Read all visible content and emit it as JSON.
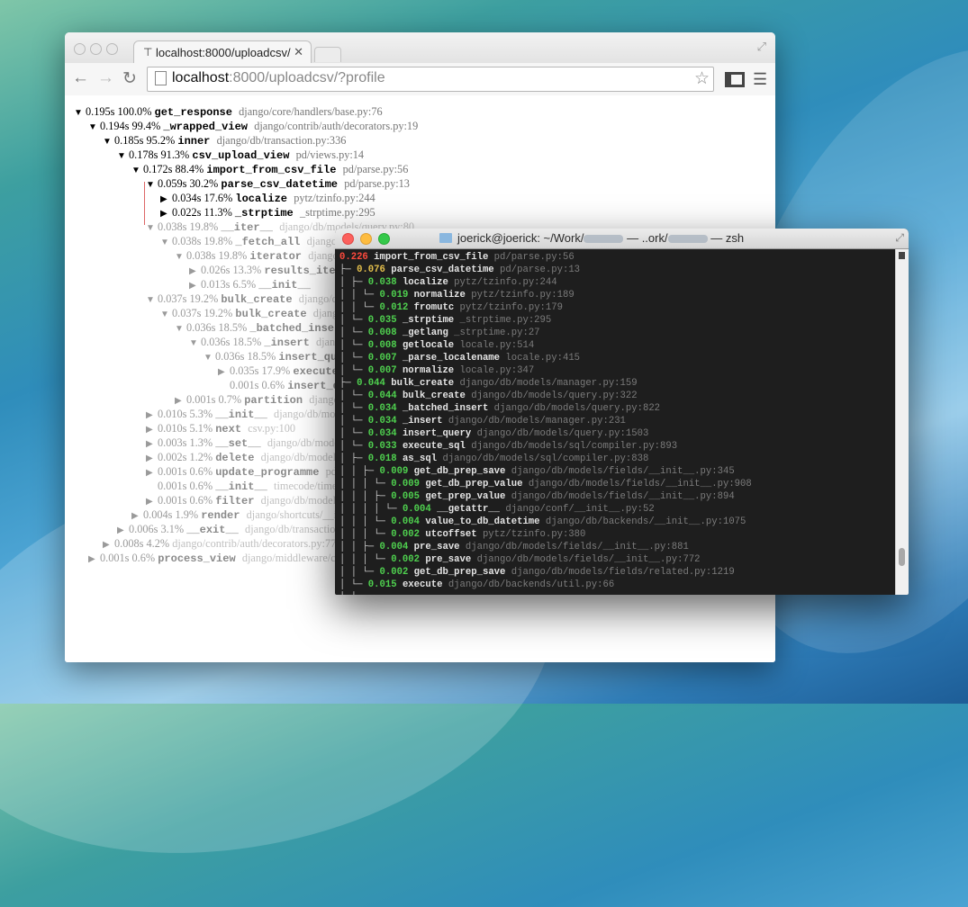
{
  "desktop": {
    "wallpaper": "ocean-wave"
  },
  "browser": {
    "tab_title": "localhost:8000/uploadcsv/",
    "tab_icon": "page-icon",
    "url_host": "localhost",
    "url_rest": ":8000/uploadcsv/?profile",
    "profile_rows": [
      {
        "time": "0.195s",
        "pct": "100.0%",
        "fn": "get_response",
        "loc": "django/core/handlers/base.py:76",
        "toggle": "open",
        "dim": false
      },
      {
        "time": "0.194s",
        "pct": "99.4%",
        "fn": "_wrapped_view",
        "loc": "django/contrib/auth/decorators.py:19",
        "toggle": "open",
        "dim": false
      },
      {
        "time": "0.185s",
        "pct": "95.2%",
        "fn": "inner",
        "loc": "django/db/transaction.py:336",
        "toggle": "open",
        "dim": false
      },
      {
        "time": "0.178s",
        "pct": "91.3%",
        "fn": "csv_upload_view",
        "loc": "pd/views.py:14",
        "toggle": "open",
        "dim": false
      },
      {
        "time": "0.172s",
        "pct": "88.4%",
        "fn": "import_from_csv_file",
        "loc": "pd/parse.py:56",
        "toggle": "open",
        "dim": false
      },
      {
        "time": "0.059s",
        "pct": "30.2%",
        "fn": "parse_csv_datetime",
        "loc": "pd/parse.py:13",
        "toggle": "open",
        "dim": false
      },
      {
        "time": "0.034s",
        "pct": "17.6%",
        "fn": "localize",
        "loc": "pytz/tzinfo.py:244",
        "toggle": "closed",
        "dim": false
      },
      {
        "time": "0.022s",
        "pct": "11.3%",
        "fn": "_strptime",
        "loc": "_strptime.py:295",
        "toggle": "closed",
        "dim": false
      },
      {
        "time": "0.038s",
        "pct": "19.8%",
        "fn": "__iter__",
        "loc": "django/db/models/query.py:80",
        "toggle": "open",
        "dim": true
      },
      {
        "time": "0.038s",
        "pct": "19.8%",
        "fn": "_fetch_all",
        "loc": "django/db/models/query.py",
        "toggle": "open",
        "dim": true
      },
      {
        "time": "0.038s",
        "pct": "19.8%",
        "fn": "iterator",
        "loc": "django/db/models/query.py",
        "toggle": "open",
        "dim": true
      },
      {
        "time": "0.026s",
        "pct": "13.3%",
        "fn": "results_iter",
        "loc": "",
        "toggle": "closed",
        "dim": true
      },
      {
        "time": "0.013s",
        "pct": "6.5%",
        "fn": "__init__",
        "loc": "",
        "toggle": "closed",
        "dim": true
      },
      {
        "time": "0.037s",
        "pct": "19.2%",
        "fn": "bulk_create",
        "loc": "django/db/models/manager.py",
        "toggle": "open",
        "dim": true
      },
      {
        "time": "0.037s",
        "pct": "19.2%",
        "fn": "bulk_create",
        "loc": "django/db/models/query.py",
        "toggle": "open",
        "dim": true
      },
      {
        "time": "0.036s",
        "pct": "18.5%",
        "fn": "_batched_insert",
        "loc": "",
        "toggle": "open",
        "dim": true
      },
      {
        "time": "0.036s",
        "pct": "18.5%",
        "fn": "_insert",
        "loc": "django/db/models/manager.py",
        "toggle": "open",
        "dim": true
      },
      {
        "time": "0.036s",
        "pct": "18.5%",
        "fn": "insert_query",
        "loc": "django/db/models/query.py",
        "toggle": "open",
        "dim": true
      },
      {
        "time": "0.035s",
        "pct": "17.9%",
        "fn": "execute_sql",
        "loc": "django/db/models/sql/compiler.py",
        "toggle": "closed",
        "dim": true
      },
      {
        "time": "0.001s",
        "pct": "0.6%",
        "fn": "insert_query",
        "loc": "",
        "toggle": "none",
        "dim": true
      },
      {
        "time": "0.001s",
        "pct": "0.7%",
        "fn": "partition",
        "loc": "django/utils/functional.py",
        "toggle": "closed",
        "dim": true
      },
      {
        "time": "0.010s",
        "pct": "5.3%",
        "fn": "__init__",
        "loc": "django/db/models/base.py",
        "toggle": "closed",
        "dim": true
      },
      {
        "time": "0.010s",
        "pct": "5.1%",
        "fn": "next",
        "loc": "csv.py:100",
        "toggle": "closed",
        "dim": true
      },
      {
        "time": "0.003s",
        "pct": "1.3%",
        "fn": "__set__",
        "loc": "django/db/models/fields/related.py",
        "toggle": "closed",
        "dim": true
      },
      {
        "time": "0.002s",
        "pct": "1.2%",
        "fn": "delete",
        "loc": "django/db/models/query.py:444",
        "toggle": "closed",
        "dim": true
      },
      {
        "time": "0.001s",
        "pct": "0.6%",
        "fn": "update_programme",
        "loc": "pd/parse.py:139",
        "toggle": "closed",
        "dim": true
      },
      {
        "time": "0.001s",
        "pct": "0.6%",
        "fn": "__init__",
        "loc": "timecode/timecode.py",
        "toggle": "none",
        "dim": true
      },
      {
        "time": "0.001s",
        "pct": "0.6%",
        "fn": "filter",
        "loc": "django/db/models/query.py:670",
        "toggle": "closed",
        "dim": true
      },
      {
        "time": "0.004s",
        "pct": "1.9%",
        "fn": "render",
        "loc": "django/shortcuts/__init__.py:31",
        "toggle": "closed",
        "dim": true
      },
      {
        "time": "0.006s",
        "pct": "3.1%",
        "fn": "__exit__",
        "loc": "django/db/transaction.py:283",
        "toggle": "closed",
        "dim": true
      },
      {
        "time": "0.008s",
        "pct": "4.2%",
        "fn": "",
        "loc": "django/contrib/auth/decorators.py:77",
        "toggle": "closed",
        "dim": true
      },
      {
        "time": "0.001s",
        "pct": "0.6%",
        "fn": "process_view",
        "loc": "django/middleware/csrf.py:102",
        "toggle": "closed",
        "dim": true
      }
    ]
  },
  "terminal": {
    "title_pre": "joerick@joerick: ~/Work/",
    "title_mid": " — ..ork/",
    "title_post": " — zsh",
    "colors": {
      "red": "#ff4a3d",
      "yellow": "#e5c04c",
      "green": "#4fd14f",
      "gray": "#7c7c7c"
    },
    "rows": [
      {
        "tree": "",
        "time": "0.226",
        "c": "red",
        "fn": "import_from_csv_file",
        "loc": "pd/parse.py:56"
      },
      {
        "tree": "├─ ",
        "time": "0.076",
        "c": "yel",
        "fn": "parse_csv_datetime",
        "loc": "pd/parse.py:13"
      },
      {
        "tree": "│  ├─ ",
        "time": "0.038",
        "c": "grn",
        "fn": "localize",
        "loc": "pytz/tzinfo.py:244"
      },
      {
        "tree": "│  │  └─ ",
        "time": "0.019",
        "c": "grn",
        "fn": "normalize",
        "loc": "pytz/tzinfo.py:189"
      },
      {
        "tree": "│  │     └─ ",
        "time": "0.012",
        "c": "grn",
        "fn": "fromutc",
        "loc": "pytz/tzinfo.py:179"
      },
      {
        "tree": "│  └─ ",
        "time": "0.035",
        "c": "grn",
        "fn": "_strptime",
        "loc": "_strptime.py:295"
      },
      {
        "tree": "│     └─ ",
        "time": "0.008",
        "c": "grn",
        "fn": "_getlang",
        "loc": "_strptime.py:27"
      },
      {
        "tree": "│        └─ ",
        "time": "0.008",
        "c": "grn",
        "fn": "getlocale",
        "loc": "locale.py:514"
      },
      {
        "tree": "│           └─ ",
        "time": "0.007",
        "c": "grn",
        "fn": "_parse_localename",
        "loc": "locale.py:415"
      },
      {
        "tree": "│              └─ ",
        "time": "0.007",
        "c": "grn",
        "fn": "normalize",
        "loc": "locale.py:347"
      },
      {
        "tree": "├─ ",
        "time": "0.044",
        "c": "grn",
        "fn": "bulk_create",
        "loc": "django/db/models/manager.py:159"
      },
      {
        "tree": "│  └─ ",
        "time": "0.044",
        "c": "grn",
        "fn": "bulk_create",
        "loc": "django/db/models/query.py:322"
      },
      {
        "tree": "│     └─ ",
        "time": "0.034",
        "c": "grn",
        "fn": "_batched_insert",
        "loc": "django/db/models/query.py:822"
      },
      {
        "tree": "│        └─ ",
        "time": "0.034",
        "c": "grn",
        "fn": "_insert",
        "loc": "django/db/models/manager.py:231"
      },
      {
        "tree": "│           └─ ",
        "time": "0.034",
        "c": "grn",
        "fn": "insert_query",
        "loc": "django/db/models/query.py:1503"
      },
      {
        "tree": "│              └─ ",
        "time": "0.033",
        "c": "grn",
        "fn": "execute_sql",
        "loc": "django/db/models/sql/compiler.py:893"
      },
      {
        "tree": "│                 ├─ ",
        "time": "0.018",
        "c": "grn",
        "fn": "as_sql",
        "loc": "django/db/models/sql/compiler.py:838"
      },
      {
        "tree": "│                 │  ├─ ",
        "time": "0.009",
        "c": "grn",
        "fn": "get_db_prep_save",
        "loc": "django/db/models/fields/__init__.py:345"
      },
      {
        "tree": "│                 │  │  └─ ",
        "time": "0.009",
        "c": "grn",
        "fn": "get_db_prep_value",
        "loc": "django/db/models/fields/__init__.py:908"
      },
      {
        "tree": "│                 │  │     ├─ ",
        "time": "0.005",
        "c": "grn",
        "fn": "get_prep_value",
        "loc": "django/db/models/fields/__init__.py:894"
      },
      {
        "tree": "│                 │  │     │  └─ ",
        "time": "0.004",
        "c": "grn",
        "fn": "__getattr__",
        "loc": "django/conf/__init__.py:52"
      },
      {
        "tree": "│                 │  │     └─ ",
        "time": "0.004",
        "c": "grn",
        "fn": "value_to_db_datetime",
        "loc": "django/db/backends/__init__.py:1075"
      },
      {
        "tree": "│                 │  │        └─ ",
        "time": "0.002",
        "c": "grn",
        "fn": "utcoffset",
        "loc": "pytz/tzinfo.py:380"
      },
      {
        "tree": "│                 │  ├─ ",
        "time": "0.004",
        "c": "grn",
        "fn": "pre_save",
        "loc": "django/db/models/fields/__init__.py:881"
      },
      {
        "tree": "│                 │  │  └─ ",
        "time": "0.002",
        "c": "grn",
        "fn": "pre_save",
        "loc": "django/db/models/fields/__init__.py:772"
      },
      {
        "tree": "│                 │  └─ ",
        "time": "0.002",
        "c": "grn",
        "fn": "get_db_prep_save",
        "loc": "django/db/models/fields/related.py:1219"
      },
      {
        "tree": "│                 └─ ",
        "time": "0.015",
        "c": "grn",
        "fn": "execute",
        "loc": "django/db/backends/util.py:66"
      },
      {
        "tree": "│     │",
        "time": "",
        "c": "grn",
        "fn": "",
        "loc": ""
      }
    ]
  }
}
